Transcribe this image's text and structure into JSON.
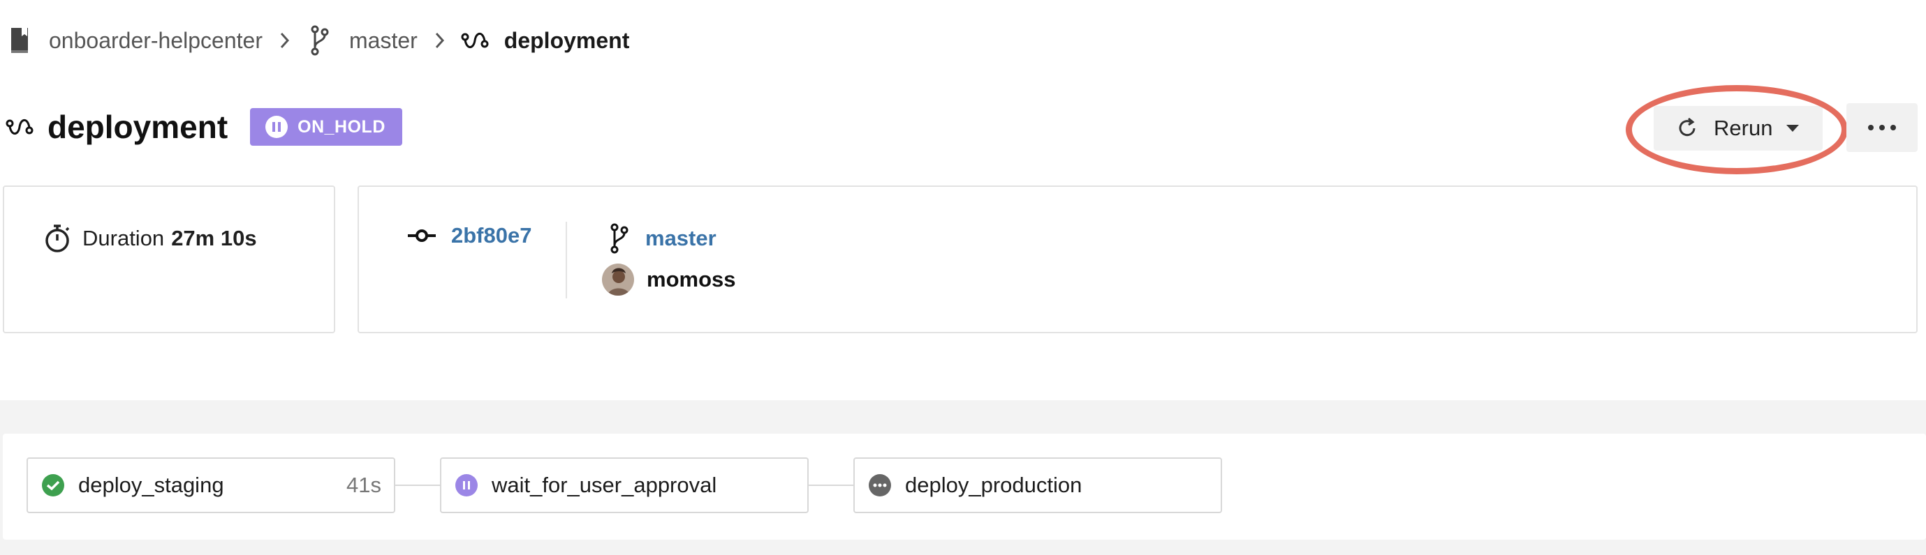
{
  "breadcrumb": {
    "project": "onboarder-helpcenter",
    "branch": "master",
    "workflow": "deployment"
  },
  "header": {
    "title": "deployment",
    "status": "ON_HOLD",
    "status_color": "#9b86e6"
  },
  "actions": {
    "rerun_label": "Rerun",
    "highlight_color": "#e46d5e"
  },
  "summary": {
    "duration_label": "Duration",
    "duration_value": "27m 10s",
    "commit_sha": "2bf80e7",
    "branch": "master",
    "author": "momoss",
    "link_color": "#3a73a8"
  },
  "pipeline": {
    "jobs": [
      {
        "name": "deploy_staging",
        "time": "41s",
        "status": "success",
        "status_color": "#3ea04f"
      },
      {
        "name": "wait_for_user_approval",
        "time": "",
        "status": "on_hold",
        "status_color": "#9b86e6"
      },
      {
        "name": "deploy_production",
        "time": "",
        "status": "blocked",
        "status_color": "#666666"
      }
    ]
  },
  "icons": {
    "project": "book-icon",
    "branch": "git-branch-icon",
    "workflow": "workflow-icon",
    "duration": "stopwatch-icon",
    "commit": "commit-icon",
    "rerun": "refresh-icon",
    "more": "ellipsis-icon"
  }
}
